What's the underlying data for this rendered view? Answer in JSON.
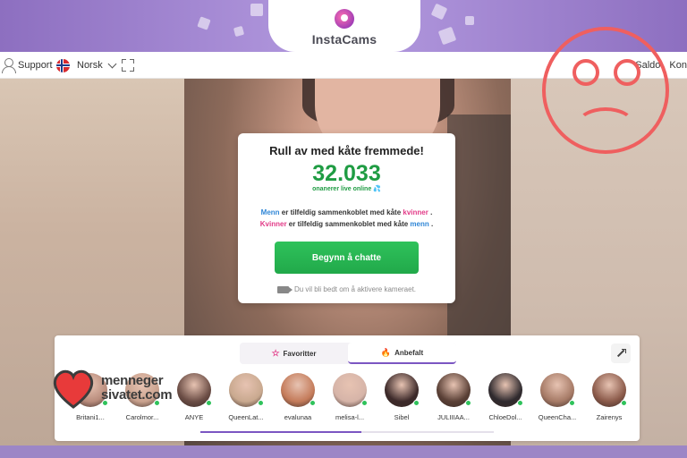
{
  "brand": {
    "name": "InstaCams"
  },
  "nav": {
    "support_label": "Support",
    "language_label": "Norsk",
    "right_link_1": "Saldo",
    "right_link_2": "Kon"
  },
  "card": {
    "title": "Rull av med kåte fremmede!",
    "counter": "32.033",
    "counter_sub": "onanerer live online",
    "line1_a": "Menn",
    "line1_b": " er tilfeldig sammenkoblet med kåte ",
    "line1_c": "kvinner",
    "line1_d": " .",
    "line2_a": "Kvinner",
    "line2_b": " er tilfeldig sammenkoblet med kåte ",
    "line2_c": "menn",
    "line2_d": " .",
    "cta_label": "Begynn å chatte",
    "camera_note": "Du vil bli bedt om å aktivere kameraet."
  },
  "tabs": [
    {
      "label": "Favoritter"
    },
    {
      "label": "Anbefalt"
    }
  ],
  "models": [
    {
      "name": "Britani1...",
      "color": "#b98c7c"
    },
    {
      "name": "Carolmor...",
      "color": "#caa28e"
    },
    {
      "name": "ANYE",
      "color": "#6b4d45"
    },
    {
      "name": "QueenLat...",
      "color": "#c9a98f"
    },
    {
      "name": "evalunaa",
      "color": "#c47b5a"
    },
    {
      "name": "melisa-l...",
      "color": "#d6b4a8"
    },
    {
      "name": "Sibel",
      "color": "#3d2a2a"
    },
    {
      "name": "JULIIIAA...",
      "color": "#5a4036"
    },
    {
      "name": "ChloeDol...",
      "color": "#2f2a2e"
    },
    {
      "name": "QueenCha...",
      "color": "#a67a66"
    },
    {
      "name": "Zairenys",
      "color": "#8b5a4a"
    }
  ],
  "carousel_progress": 0.55,
  "watermark": {
    "line1": "menneger",
    "line2": "sivatet.com"
  },
  "colors": {
    "accent": "#7b56c2",
    "green": "#1f9c43",
    "pink": "#e23a87",
    "blue": "#2f86d6",
    "sad_red": "#ef5f5f"
  }
}
